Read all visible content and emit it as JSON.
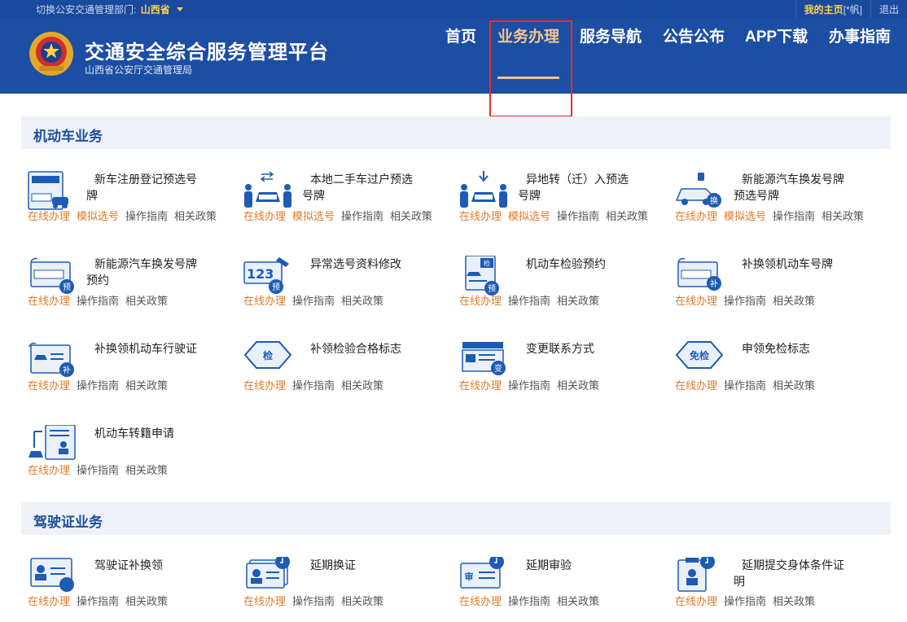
{
  "topbar": {
    "dept_label": "切换公安交通管理部门:",
    "province": "山西省",
    "home_label": "我的主页",
    "user": "[*帆]",
    "logout": "退出"
  },
  "header": {
    "title": "交通安全综合服务管理平台",
    "subtitle": "山西省公安厅交通管理局",
    "nav": [
      "首页",
      "业务办理",
      "服务导航",
      "公告公布",
      "APP下载",
      "办事指南"
    ],
    "active_nav": "业务办理"
  },
  "colors": {
    "brand": "#1c4ea3",
    "accent": "#f3c58a",
    "action": "#e07b2a",
    "highlight_box": "#e0302a"
  },
  "actions": {
    "online": "在线办理",
    "simulate": "模拟选号",
    "guide": "操作指南",
    "policy": "相关政策"
  },
  "motor": {
    "title": "机动车业务",
    "items": [
      {
        "name": "新车注册登记预选号牌",
        "icon": "new-plate-icon",
        "sim": true
      },
      {
        "name": "本地二手车过户预选号牌",
        "icon": "transfer-people-icon",
        "sim": true
      },
      {
        "name": "异地转（迁）入预选号牌",
        "icon": "relocate-car-icon",
        "sim": true
      },
      {
        "name": "新能源汽车换发号牌预选号牌",
        "icon": "ev-car-icon",
        "sim": true
      },
      {
        "name": "新能源汽车换发号牌预约",
        "icon": "ev-plate-reserve-icon",
        "sim": false
      },
      {
        "name": "异常选号资料修改",
        "icon": "number-edit-icon",
        "sim": false
      },
      {
        "name": "机动车检验预约",
        "icon": "inspection-reserve-icon",
        "sim": false
      },
      {
        "name": "补换领机动车号牌",
        "icon": "plate-reissue-icon",
        "sim": false
      },
      {
        "name": "补换领机动车行驶证",
        "icon": "license-reissue-icon",
        "sim": false
      },
      {
        "name": "补领检验合格标志",
        "icon": "inspection-badge-icon",
        "sim": false
      },
      {
        "name": "变更联系方式",
        "icon": "contact-change-icon",
        "sim": false
      },
      {
        "name": "申领免检标志",
        "icon": "exempt-badge-icon",
        "sim": false
      },
      {
        "name": "机动车转籍申请",
        "icon": "registry-transfer-icon",
        "sim": false
      }
    ]
  },
  "driver": {
    "title": "驾驶证业务",
    "items": [
      {
        "name": "驾驶证补换领",
        "icon": "driver-license-reissue-icon"
      },
      {
        "name": "延期换证",
        "icon": "renewal-delay-icon"
      },
      {
        "name": "延期审验",
        "icon": "audit-delay-icon"
      },
      {
        "name": "延期提交身体条件证明",
        "icon": "health-cert-delay-icon"
      }
    ]
  },
  "badges": {
    "yu": "预",
    "bu": "补",
    "bian": "变",
    "huan": "换",
    "jian": "检",
    "mianjian": "免检",
    "shen": "审",
    "num": "123"
  }
}
